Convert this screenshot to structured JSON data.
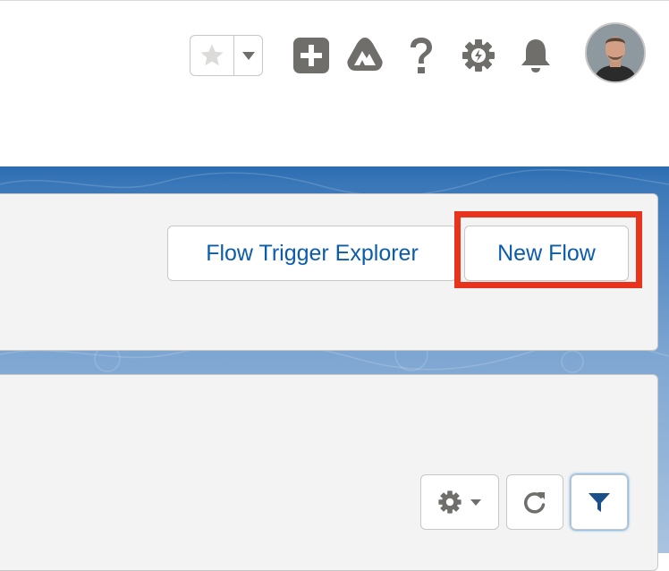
{
  "header": {
    "favorites_star_icon": "star-icon",
    "favorites_dropdown_icon": "chevron-down-icon",
    "icons": [
      "add-icon",
      "trailhead-icon",
      "help-icon",
      "setup-gear-icon",
      "notification-bell-icon"
    ],
    "avatar": "user-avatar"
  },
  "page_header": {
    "flow_trigger_explorer_label": "Flow Trigger Explorer",
    "new_flow_label": "New Flow"
  },
  "list_toolbar": {
    "settings_icon": "gear-icon",
    "refresh_icon": "refresh-icon",
    "filter_icon": "filter-icon"
  },
  "colors": {
    "brand_blue": "#0b5cab",
    "banner_blue": "#2b6cb0",
    "highlight_red": "#e8331d",
    "icon_gray": "#706e6b",
    "filter_icon_blue": "#1b4f8a"
  }
}
